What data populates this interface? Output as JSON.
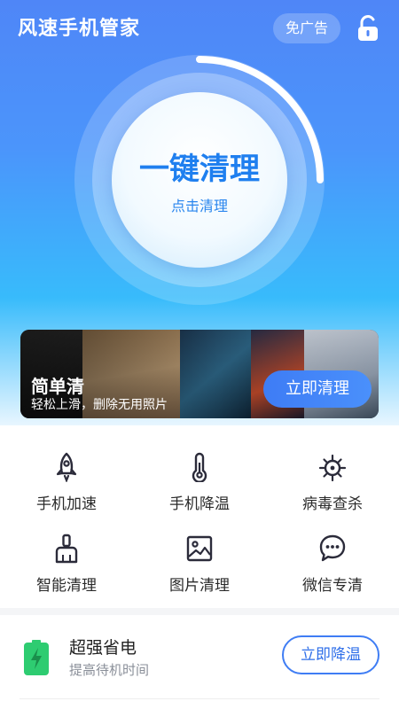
{
  "header": {
    "app_title": "风速手机管家",
    "ad_free_label": "免广告",
    "lock_icon": "unlock-icon"
  },
  "hero": {
    "title": "一键清理",
    "subtitle": "点击清理"
  },
  "banner": {
    "title": "简单清",
    "subtitle": "轻松上滑，删除无用照片",
    "button_label": "立即清理"
  },
  "tools": [
    {
      "label": "手机加速",
      "icon": "rocket-icon"
    },
    {
      "label": "手机降温",
      "icon": "thermometer-icon"
    },
    {
      "label": "病毒查杀",
      "icon": "virus-icon"
    },
    {
      "label": "智能清理",
      "icon": "broom-icon"
    },
    {
      "label": "图片清理",
      "icon": "image-icon"
    },
    {
      "label": "微信专清",
      "icon": "chat-bubble-icon"
    }
  ],
  "power_card": {
    "title": "超强省电",
    "subtitle": "提高待机时间",
    "button_label": "立即降温",
    "icon": "battery-charging-icon"
  },
  "colors": {
    "brand_blue": "#3f7df4",
    "hero_top": "#4f86f7",
    "hero_bottom": "#38bbfb",
    "battery_green": "#2ecc71"
  }
}
